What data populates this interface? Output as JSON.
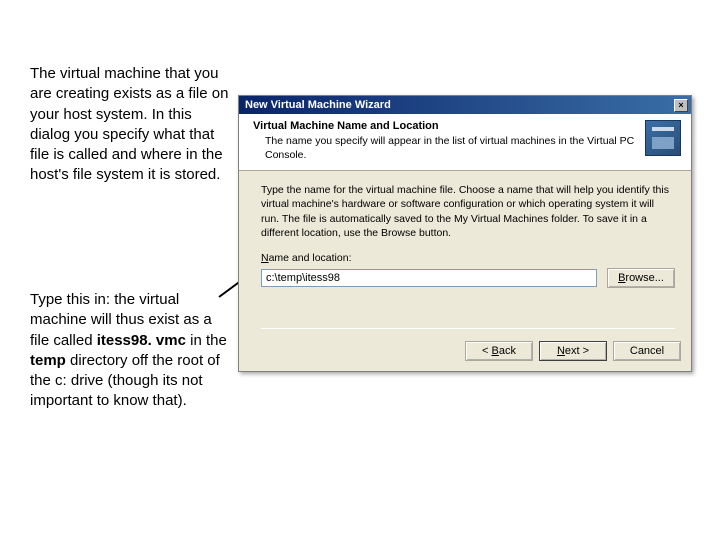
{
  "notes": {
    "para1": "The virtual machine that you are creating exists as a file on your host system. In this dialog you specify what that file is called and where in the host's file system it is stored.",
    "para2_lead": "Type this in: the virtual machine will thus exist as a file called ",
    "para2_file": "itess98. vmc",
    "para2_mid": " in the ",
    "para2_dir": "temp",
    "para2_tail": " directory off the root of the c: drive (though its not important to know that)."
  },
  "dialog": {
    "title": "New Virtual Machine Wizard",
    "close_glyph": "×",
    "header_title": "Virtual Machine Name and Location",
    "header_sub": "The name you specify will appear in the list of virtual machines in the Virtual PC Console.",
    "instruction": "Type the name for the virtual machine file. Choose a name that will help you identify this virtual machine's hardware or software configuration or which operating system it will run. The file is automatically saved to the My Virtual Machines folder. To save it in a different location, use the Browse button.",
    "field_label_prefix": "N",
    "field_label_rest": "ame and location:",
    "input_value": "c:\\temp\\itess98",
    "browse_prefix": "B",
    "browse_rest": "rowse...",
    "back_prefix": "< ",
    "back_ul": "B",
    "back_rest": "ack",
    "next_ul": "N",
    "next_rest": "ext >",
    "cancel": "Cancel"
  }
}
